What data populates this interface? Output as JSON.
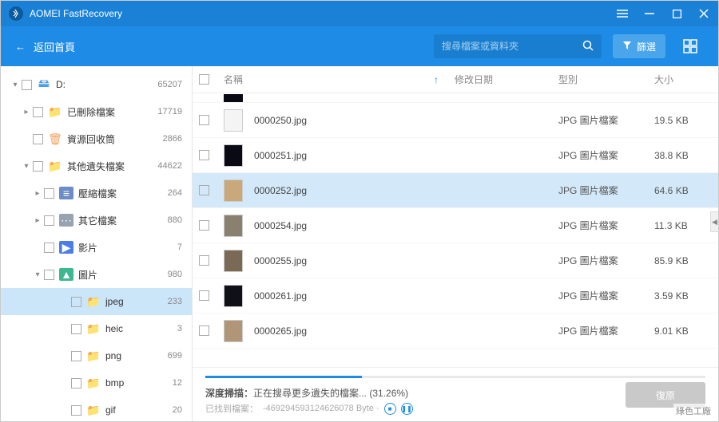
{
  "app": {
    "title": "AOMEI FastRecovery"
  },
  "toolbar": {
    "back_label": "返回首頁",
    "search_placeholder": "搜尋檔案或資料夾",
    "filter_label": "篩選"
  },
  "sidebar": {
    "items": [
      {
        "indent": 12,
        "chevron": "▾",
        "icon": "drive",
        "label": "D:",
        "count": "65207"
      },
      {
        "indent": 26,
        "chevron": "▸",
        "icon": "trash",
        "label": "已刪除檔案",
        "count": "17719"
      },
      {
        "indent": 26,
        "chevron": "",
        "icon": "recycle",
        "label": "資源回收筒",
        "count": "2866"
      },
      {
        "indent": 26,
        "chevron": "▾",
        "icon": "folder",
        "label": "其他遺失檔案",
        "count": "44622"
      },
      {
        "indent": 40,
        "chevron": "▸",
        "icon": "archive",
        "label": "壓縮檔案",
        "count": "264"
      },
      {
        "indent": 40,
        "chevron": "▸",
        "icon": "other",
        "label": "其它檔案",
        "count": "880"
      },
      {
        "indent": 40,
        "chevron": "",
        "icon": "video",
        "label": "影片",
        "count": "7"
      },
      {
        "indent": 40,
        "chevron": "▾",
        "icon": "image",
        "label": "圖片",
        "count": "980"
      },
      {
        "indent": 74,
        "chevron": "",
        "icon": "folder",
        "label": "jpeg",
        "count": "233",
        "selected": true
      },
      {
        "indent": 74,
        "chevron": "",
        "icon": "folder",
        "label": "heic",
        "count": "3"
      },
      {
        "indent": 74,
        "chevron": "",
        "icon": "folder",
        "label": "png",
        "count": "699"
      },
      {
        "indent": 74,
        "chevron": "",
        "icon": "folder",
        "label": "bmp",
        "count": "12"
      },
      {
        "indent": 74,
        "chevron": "",
        "icon": "folder",
        "label": "gif",
        "count": "20"
      }
    ]
  },
  "columns": {
    "name": "名稱",
    "date": "修改日期",
    "type": "型別",
    "size": "大小"
  },
  "files": [
    {
      "name": "0000250.jpg",
      "type": "JPG 圖片檔案",
      "size": "19.5 KB",
      "thumb": "#f4f4f4"
    },
    {
      "name": "0000251.jpg",
      "type": "JPG 圖片檔案",
      "size": "38.8 KB",
      "thumb": "#0a0a15"
    },
    {
      "name": "0000252.jpg",
      "type": "JPG 圖片檔案",
      "size": "64.6 KB",
      "thumb": "#c9a97a",
      "selected": true
    },
    {
      "name": "0000254.jpg",
      "type": "JPG 圖片檔案",
      "size": "11.3 KB",
      "thumb": "#8a8070"
    },
    {
      "name": "0000255.jpg",
      "type": "JPG 圖片檔案",
      "size": "85.9 KB",
      "thumb": "#7a6a55"
    },
    {
      "name": "0000261.jpg",
      "type": "JPG 圖片檔案",
      "size": "3.59 KB",
      "thumb": "#101018"
    },
    {
      "name": "0000265.jpg",
      "type": "JPG 圖片檔案",
      "size": "9.01 KB",
      "thumb": "#b09576"
    }
  ],
  "progress": {
    "label_prefix": "深度掃描：",
    "label_text": "正在搜尋更多遺失的檔案...",
    "percent_text": "(31.26%)",
    "sub_prefix": "已找到檔案：",
    "sub_value": "-469294593124626078 Byte ·",
    "recover_label": "復原"
  },
  "watermark": "綠色工廠"
}
